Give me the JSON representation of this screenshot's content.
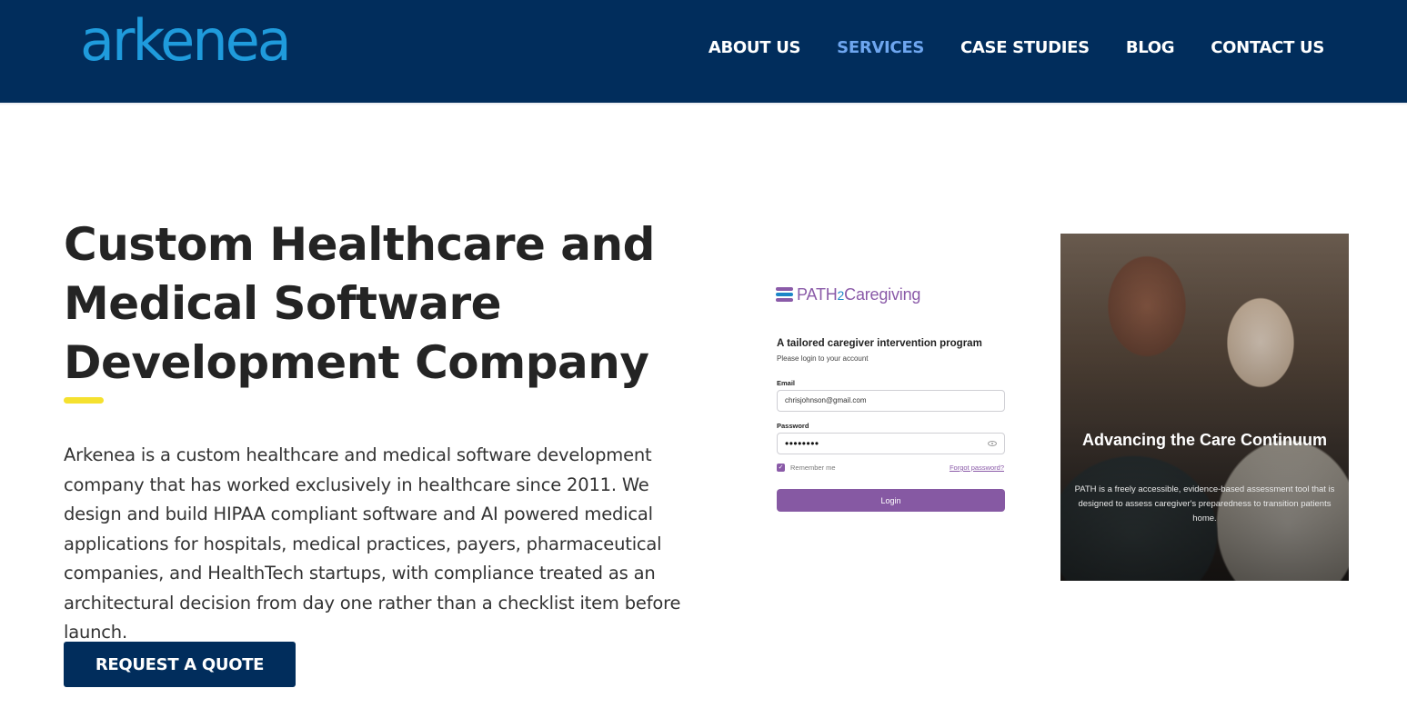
{
  "header": {
    "logo_text": "arkenea",
    "nav": [
      {
        "label": "ABOUT US"
      },
      {
        "label": "SERVICES",
        "active": true
      },
      {
        "label": "CASE STUDIES"
      },
      {
        "label": "BLOG"
      },
      {
        "label": "CONTACT US"
      }
    ]
  },
  "hero": {
    "title": "Custom Healthcare and Medical Software Development Company",
    "description": "Arkenea is a custom healthcare and medical software development company that has worked exclusively in healthcare since 2011. We design and build HIPAA compliant software and AI powered medical applications for hospitals, medical practices, payers, pharmaceutical companies, and HealthTech startups, with compliance treated as an architectural decision from day one rather than a checklist item before launch.",
    "cta_label": "REQUEST A QUOTE"
  },
  "mockup": {
    "brand_prefix": "PATH",
    "brand_two": "2",
    "brand_suffix": "Caregiving",
    "program_title": "A tailored caregiver intervention program",
    "program_subtitle": "Please login to your account",
    "email_label": "Email",
    "email_value": "chrisjohnson@gmail.com",
    "password_label": "Password",
    "password_value": "••••••••",
    "remember_label": "Remember me",
    "forgot_label": "Forgot password?",
    "login_label": "Login"
  },
  "photo_card": {
    "title": "Advancing the Care Continuum",
    "text": "PATH is a freely accessible, evidence-based assessment tool that is designed to assess caregiver's preparedness to transition patients home."
  },
  "colors": {
    "header_bg": "#012d5c",
    "logo": "#1f9bdc",
    "nav_active": "#6ea6f0",
    "accent": "#f5e12f",
    "mock_purple": "#8659a3"
  }
}
